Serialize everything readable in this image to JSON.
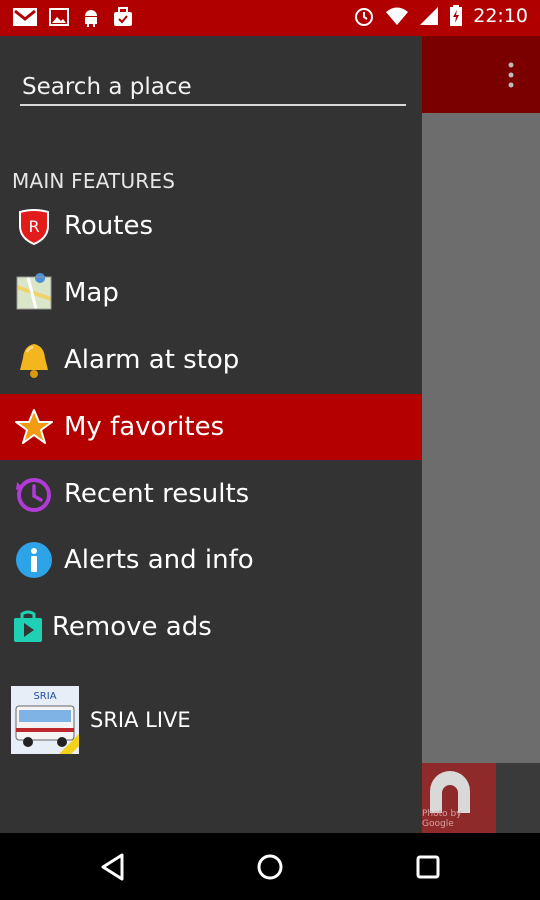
{
  "status_bar": {
    "time": "22:10",
    "left_icons": [
      "gmail-icon",
      "image-icon",
      "android-icon",
      "briefcase-icon"
    ],
    "right_icons": [
      "alarm-icon",
      "wifi-icon",
      "signal-icon",
      "battery-icon"
    ]
  },
  "drawer": {
    "search": {
      "placeholder": "Search a place",
      "value": ""
    },
    "section_header": "MAIN FEATURES",
    "items": [
      {
        "label": "Routes",
        "icon": "routes-shield-icon"
      },
      {
        "label": "Map",
        "icon": "map-icon"
      },
      {
        "label": "Alarm at stop",
        "icon": "bell-icon"
      },
      {
        "label": "My favorites",
        "icon": "star-icon",
        "selected": true
      },
      {
        "label": "Recent results",
        "icon": "history-icon"
      },
      {
        "label": "Alerts and info",
        "icon": "info-icon"
      },
      {
        "label": "Remove ads",
        "icon": "play-store-icon"
      }
    ],
    "promo": {
      "label": "SRIA LIVE",
      "thumb_text": "SRIA"
    }
  },
  "background": {
    "ad_credit": "Photo by Google"
  },
  "colors": {
    "status_bar": "#b00000",
    "drawer_bg": "#333333",
    "selected_bg": "#b50000",
    "app_toolbar": "#7a0000"
  }
}
